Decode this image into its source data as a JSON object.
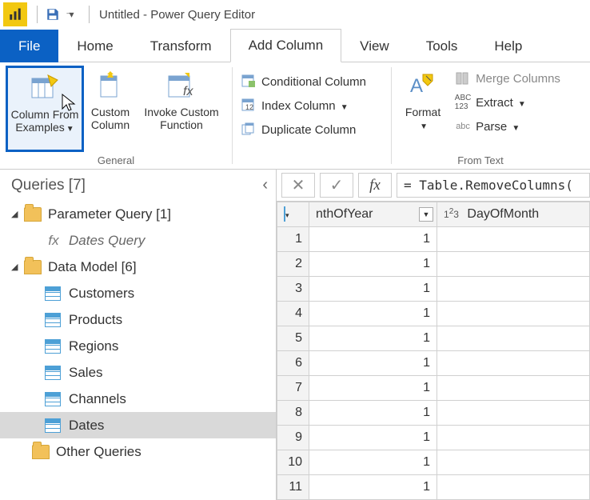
{
  "titlebar": {
    "title": "Untitled - Power Query Editor"
  },
  "tabs": {
    "file": "File",
    "home": "Home",
    "transform": "Transform",
    "addcolumn": "Add Column",
    "view": "View",
    "tools": "Tools",
    "help": "Help"
  },
  "ribbon": {
    "column_from_examples": "Column From Examples",
    "custom_column": "Custom Column",
    "invoke_custom_function": "Invoke Custom Function",
    "general_label": "General",
    "conditional_column": "Conditional Column",
    "index_column": "Index Column",
    "duplicate_column": "Duplicate Column",
    "format": "Format",
    "merge_columns": "Merge Columns",
    "extract": "Extract",
    "parse": "Parse",
    "from_text_label": "From Text"
  },
  "queries_header": "Queries [7]",
  "tree": {
    "param_query": "Parameter Query [1]",
    "dates_query_fx": "Dates Query",
    "data_model": "Data Model [6]",
    "customers": "Customers",
    "products": "Products",
    "regions": "Regions",
    "sales": "Sales",
    "channels": "Channels",
    "dates": "Dates",
    "other_queries": "Other Queries"
  },
  "formula": "= Table.RemoveColumns(",
  "grid": {
    "col1_header": "nthOfYear",
    "col2_header": "DayOfMonth",
    "col2_type": "1²3",
    "rows": [
      {
        "n": "1",
        "a": "1",
        "b": ""
      },
      {
        "n": "2",
        "a": "1",
        "b": ""
      },
      {
        "n": "3",
        "a": "1",
        "b": ""
      },
      {
        "n": "4",
        "a": "1",
        "b": ""
      },
      {
        "n": "5",
        "a": "1",
        "b": ""
      },
      {
        "n": "6",
        "a": "1",
        "b": ""
      },
      {
        "n": "7",
        "a": "1",
        "b": ""
      },
      {
        "n": "8",
        "a": "1",
        "b": ""
      },
      {
        "n": "9",
        "a": "1",
        "b": ""
      },
      {
        "n": "10",
        "a": "1",
        "b": ""
      },
      {
        "n": "11",
        "a": "1",
        "b": ""
      }
    ]
  }
}
